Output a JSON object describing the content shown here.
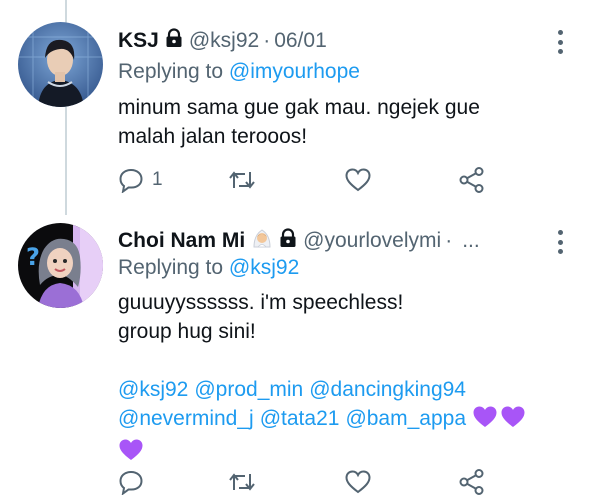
{
  "tweets": [
    {
      "name": "KSJ",
      "protected": true,
      "handle": "@ksj92",
      "separator": "·",
      "date": "06/01",
      "replying_prefix": "Replying to",
      "replying_to": "@imyourhope",
      "text_lines": [
        "minum sama gue gak mau. ngejek gue",
        "malah jalan terooos!"
      ],
      "reply_count": "1",
      "icons": [
        "reply-icon",
        "retweet-icon",
        "like-icon",
        "share-icon",
        "more-icon",
        "lock-icon"
      ]
    },
    {
      "name": "Choi Nam Mi",
      "name_emoji": "person-with-veil-emoji",
      "protected": true,
      "handle": "@yourlovelymi",
      "separator": "·",
      "truncation": "...",
      "replying_prefix": "Replying to",
      "replying_to": "@ksj92",
      "text_lines": [
        "guuuyyssssss. i'm speechless!",
        "group hug sini!"
      ],
      "mentions_line1": [
        "@ksj92",
        "@prod_min",
        "@dancingking94"
      ],
      "mentions_line2": [
        "@nevermind_j",
        "@tata21",
        "@bam_appa"
      ],
      "trailing_emoji": "purple-heart x3",
      "icons": [
        "reply-icon",
        "retweet-icon",
        "like-icon",
        "share-icon",
        "more-icon",
        "lock-icon",
        "purple-heart-icon"
      ]
    }
  ],
  "colors": {
    "text": "#0f1419",
    "secondary": "#536471",
    "link": "#1d9bf0",
    "thread_line": "#cfd9de",
    "heart_purple": "#a855f7"
  }
}
